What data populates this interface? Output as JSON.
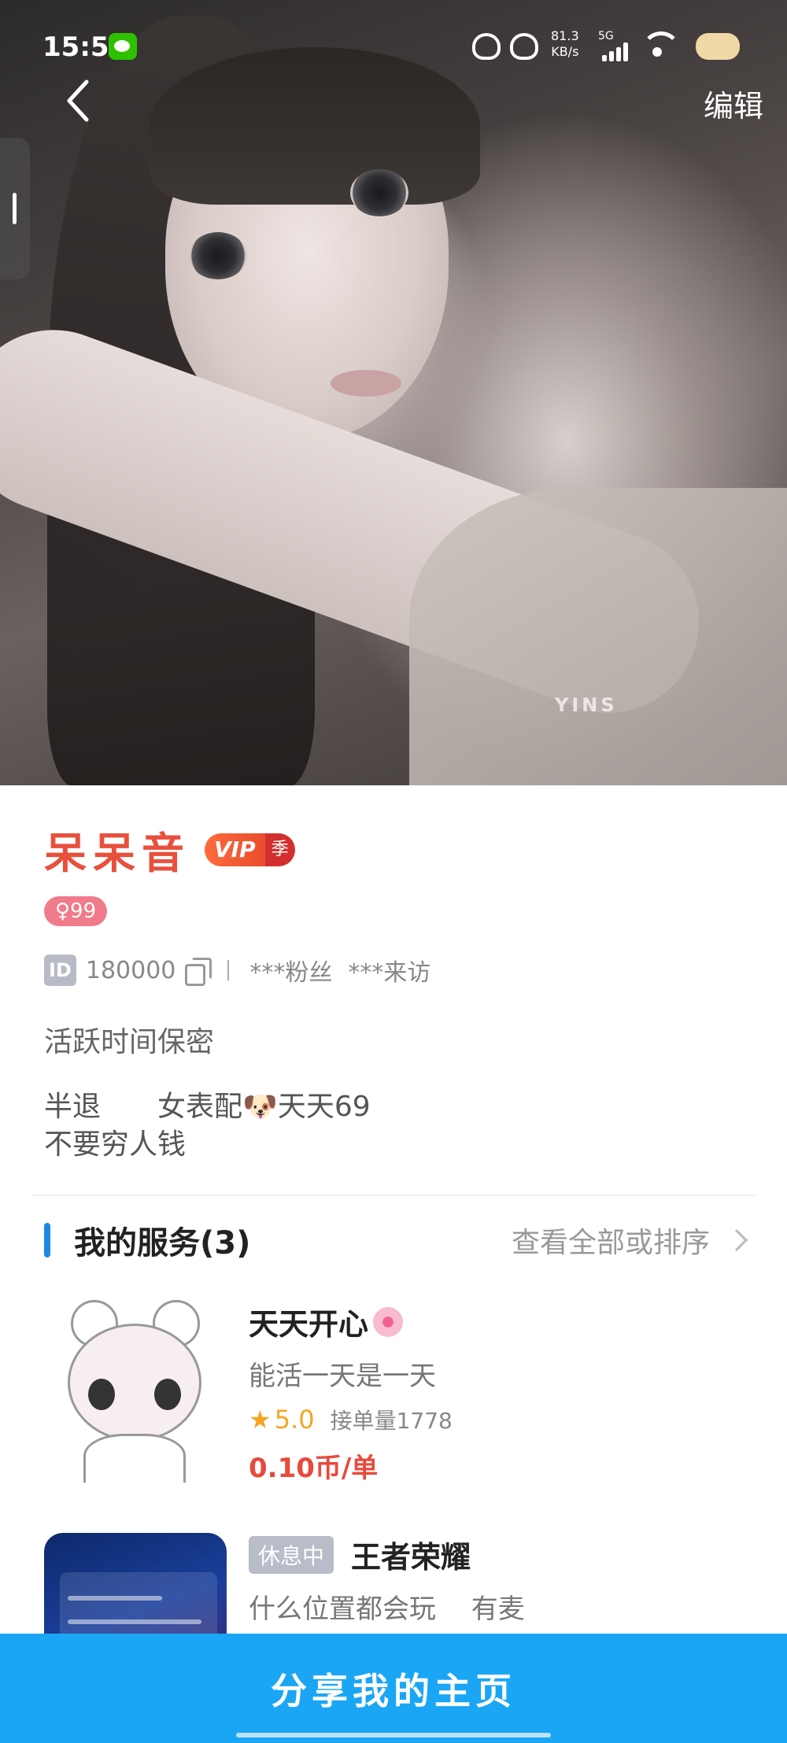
{
  "status_bar": {
    "time": "15:57",
    "speed_value": "81.3",
    "speed_unit": "KB/s",
    "network": "5G"
  },
  "nav": {
    "edit_label": "编辑"
  },
  "hero": {
    "watermark": "YINS"
  },
  "profile": {
    "name": "呆呆音",
    "vip_label": "VIP",
    "vip_tier": "季",
    "gender_age": "♀99",
    "id_badge": "ID",
    "id_value": "180000",
    "fans": "***粉丝",
    "visits": "***来访",
    "active_time": "活跃时间保密",
    "bio": "半退　　女表配🐶天天69\n不要穷人钱"
  },
  "services": {
    "title": "我的服务(3)",
    "more_label": "查看全部或排序",
    "items": [
      {
        "title": "天天开心",
        "desc": "能活一天是一天",
        "rating": "5.0",
        "orders": "接单量1778",
        "price": "0.10币/单"
      },
      {
        "status": "休息中",
        "title": "王者荣耀",
        "desc": "什么位置都会玩　 有麦"
      }
    ]
  },
  "bottom": {
    "share_label": "分享我的主页"
  },
  "colors": {
    "accent": "#1ba6f5",
    "name": "#e8503d",
    "price": "#e84a3c",
    "rating": "#f5a623"
  }
}
